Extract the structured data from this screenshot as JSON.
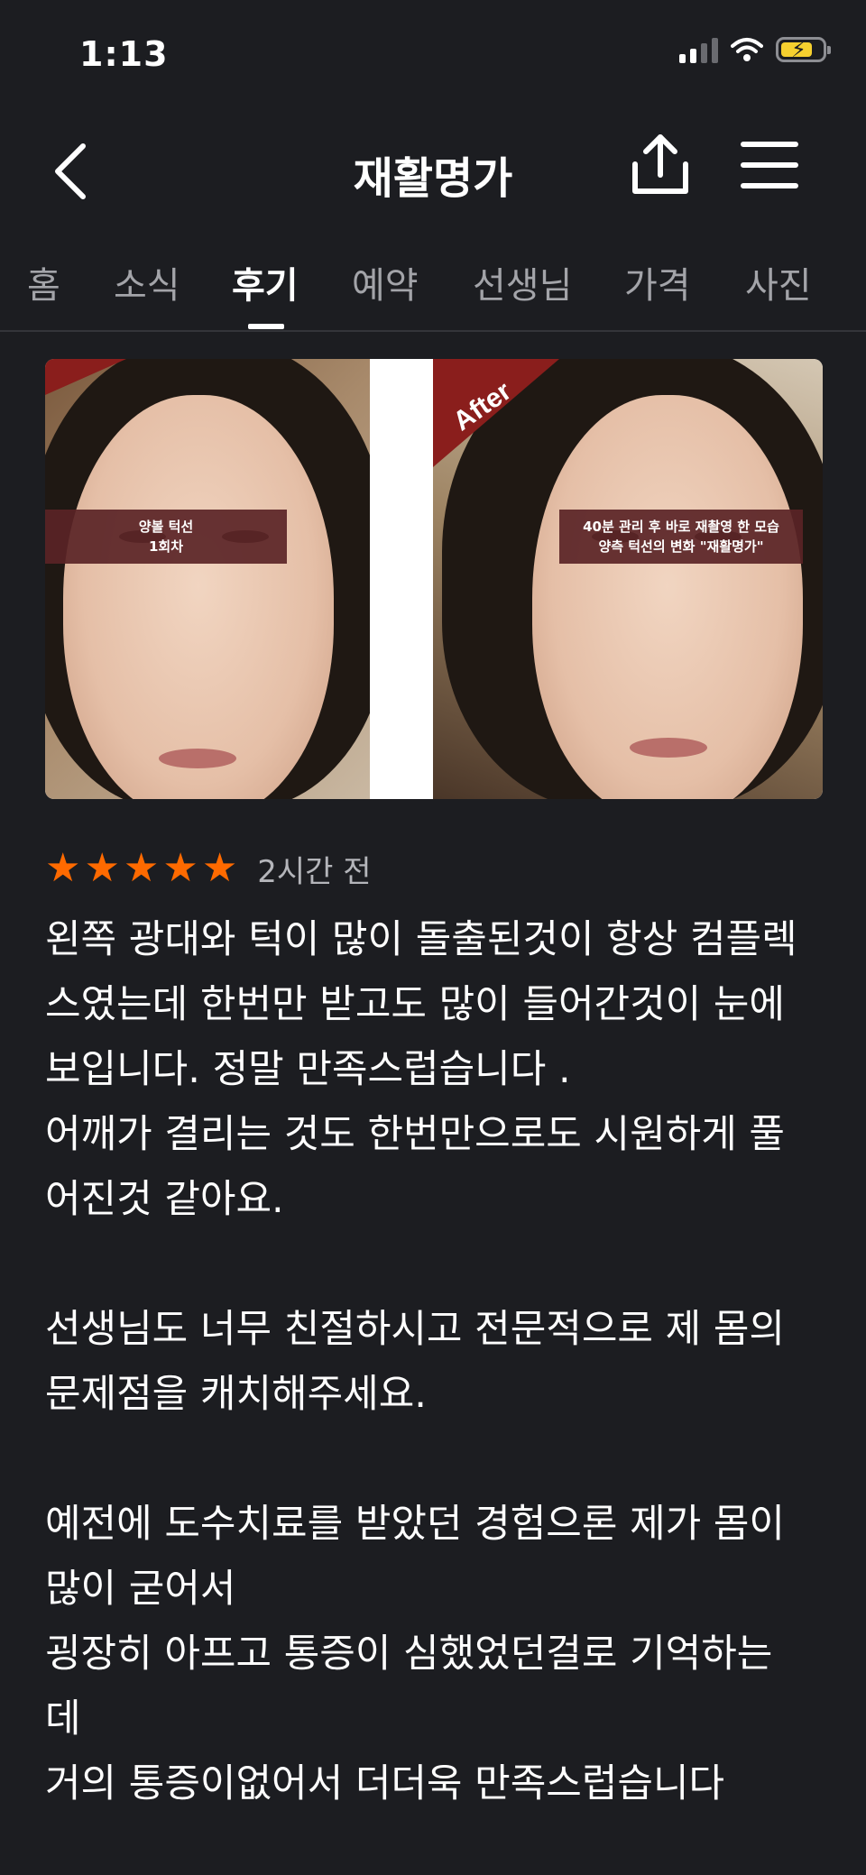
{
  "status_bar": {
    "time": "1:13",
    "battery_color": "#f6d02f"
  },
  "header": {
    "title": "재활명가"
  },
  "tabs": [
    {
      "label": "홈",
      "active": false
    },
    {
      "label": "소식",
      "active": false
    },
    {
      "label": "후기",
      "active": true
    },
    {
      "label": "예약",
      "active": false
    },
    {
      "label": "선생님",
      "active": false
    },
    {
      "label": "가격",
      "active": false
    },
    {
      "label": "사진",
      "active": false
    }
  ],
  "photo": {
    "corner_label": "After",
    "left_caption_line1": "양볼 턱선",
    "left_caption_line2": "1회차",
    "right_caption_line1": "40분 관리 후 바로 재촬영 한 모습",
    "right_caption_line2": "양측 턱선의 변화 \"재활명가\"",
    "accent_color": "#8a1e1c"
  },
  "review": {
    "rating": 5,
    "star_color": "#ff6a00",
    "time_ago": "2시간 전",
    "text": "왼쪽 광대와 턱이 많이 돌출된것이 항상 컴플렉\n스였는데 한번만 받고도 많이 들어간것이 눈에\n보입니다. 정말 만족스럽습니다 .\n어깨가 결리는 것도 한번만으로도 시원하게 풀\n어진것 같아요.\n\n선생님도 너무 친절하시고 전문적으로 제 몸의\n문제점을 캐치해주세요.\n\n예전에 도수치료를 받았던 경험으론 제가 몸이\n많이 굳어서\n굉장히 아프고 통증이 심했었던걸로 기억하는\n데\n거의 통증이없어서 더더욱 만족스럽습니다"
  }
}
